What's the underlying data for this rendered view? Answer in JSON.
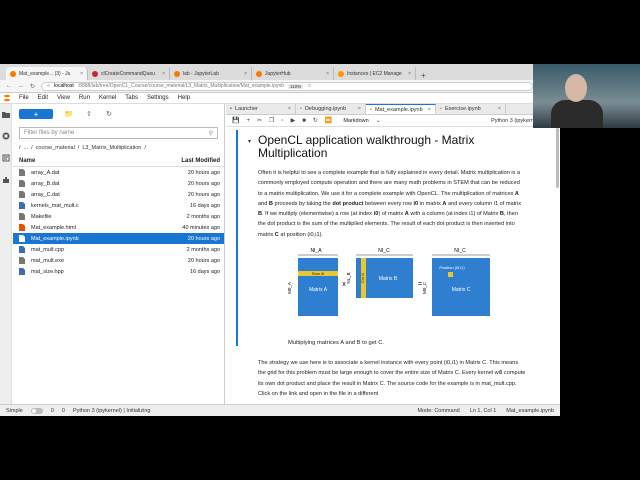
{
  "browser": {
    "tabs": [
      {
        "label": "Mat_example... (3) - Ju",
        "color": "#f57c00",
        "active": true
      },
      {
        "label": "clCreateCommandQueu",
        "color": "#c62828"
      },
      {
        "label": "lab - JupyterLab",
        "color": "#f57c00"
      },
      {
        "label": "JupyterHub",
        "color": "#f57c00"
      },
      {
        "label": "Instances | EC2 Manage",
        "color": "#ff9800"
      }
    ],
    "url_host": "localhost",
    "url_path": ":8888/lab/tree/OpenCL_Course/course_material/L3_Matrix_Multiplication/Mat_example.ipynb",
    "zoom": "110%"
  },
  "menu": [
    "File",
    "Edit",
    "View",
    "Run",
    "Kernel",
    "Tabs",
    "Settings",
    "Help"
  ],
  "filebrowser": {
    "new_label": "+",
    "filter_placeholder": "Filter files by name",
    "breadcrumbs": [
      "/",
      "...",
      "/",
      "course_material",
      "/",
      "L3_Matrix_Multiplication",
      "/"
    ],
    "col_name": "Name",
    "col_modified": "Last Modified",
    "files": [
      {
        "name": "array_A.dat",
        "modified": "20 hours ago",
        "icon": "file-icon"
      },
      {
        "name": "array_B.dat",
        "modified": "20 hours ago",
        "icon": "file-icon"
      },
      {
        "name": "array_C.dat",
        "modified": "20 hours ago",
        "icon": "file-icon"
      },
      {
        "name": "kernels_mat_mult.c",
        "modified": "16 days ago",
        "icon": "c-file-icon"
      },
      {
        "name": "Makefile",
        "modified": "2 months ago",
        "icon": "file-icon"
      },
      {
        "name": "Mat_example.html",
        "modified": "40 minutes ago",
        "icon": "html-file-icon"
      },
      {
        "name": "Mat_example.ipynb",
        "modified": "20 hours ago",
        "icon": "notebook-icon",
        "selected": true
      },
      {
        "name": "mat_mult.cpp",
        "modified": "2 months ago",
        "icon": "cpp-file-icon"
      },
      {
        "name": "mat_mult.exe",
        "modified": "20 hours ago",
        "icon": "file-icon"
      },
      {
        "name": "mat_size.hpp",
        "modified": "16 days ago",
        "icon": "cpp-file-icon"
      }
    ]
  },
  "doc_tabs": [
    {
      "label": "Launcher"
    },
    {
      "label": "Debugging.ipynb"
    },
    {
      "label": "Mat_example.ipynb",
      "active": true
    },
    {
      "label": "Exercise.ipynb"
    }
  ],
  "notebook_toolbar": {
    "cell_type": "Markdown",
    "kernel": "Python 3 (ipykernel)"
  },
  "notebook": {
    "heading": "OpenCL application walkthrough - Matrix Multiplication",
    "para1": [
      {
        "t": "Often it is helpful to see a complete example that is fully explained in every detail. Matrix multiplication is a commonly employed compute operation and there are many math problems in STEM that can be reduced to a matrix multiplication. We use it for a complete example with OpenCL. The multiplication of matrices "
      },
      {
        "t": "A",
        "b": true
      },
      {
        "t": " and "
      },
      {
        "t": "B",
        "b": true
      },
      {
        "t": " proceeds by taking the "
      },
      {
        "t": "dot product",
        "b": true
      },
      {
        "t": " between every row "
      },
      {
        "t": "i0",
        "b": true
      },
      {
        "t": " in matrix "
      },
      {
        "t": "A",
        "b": true
      },
      {
        "t": " and every column i1 of matrix "
      },
      {
        "t": "B",
        "b": true
      },
      {
        "t": ". If we multiply (elementwise) a row (at index "
      },
      {
        "t": "i0",
        "b": true
      },
      {
        "t": ") of matrix "
      },
      {
        "t": "A",
        "b": true
      },
      {
        "t": " with a column (at index i1) of Matrix "
      },
      {
        "t": "B",
        "b": true
      },
      {
        "t": ", then the dot product is the sum of the multiplied elements. The result of each dot product is then inserted into matrix "
      },
      {
        "t": "C",
        "b": true
      },
      {
        "t": " at position (i0,i1)."
      }
    ],
    "figure": {
      "nl_a_top": "NI_A",
      "nl_c_top": "NI_C",
      "m_a_side": "M0_A",
      "m_b_side": "NL_B",
      "m_c_side": "M0_C",
      "row_label": "Row i0",
      "col_label": "Col i1",
      "position_label": "Position (i0,i1)",
      "matrix_a": "Matrix A",
      "matrix_b": "Matrix B",
      "matrix_c": "Matrix C",
      "times": "x",
      "equals": "=",
      "nl_c_mid": "NI_C"
    },
    "caption": "Multiplying matrices A and B to get C.",
    "para2": "The strategy we use here is to associate a kernel instance with every point (i0,i1) in Matrix C. This means the grid for this problem must be large enough to cover the entire size of Matrix C. Every kernel will compute its own dot product and place the result in Matrix C. The source code for the example is in mat_mult.cpp. Click on the link and open in the file in a different"
  },
  "status": {
    "mode_label": "Simple",
    "zero1": "0",
    "zero2": "0",
    "kernel": "Python 3 (ipykernel) | Initializing",
    "mode": "Mode: Command",
    "position": "Ln 1, Col 1",
    "filename": "Mat_example.ipynb"
  },
  "colors": {
    "accent": "#1976d2",
    "matrix": "#2f7fd1",
    "highlight": "#e8c830"
  }
}
